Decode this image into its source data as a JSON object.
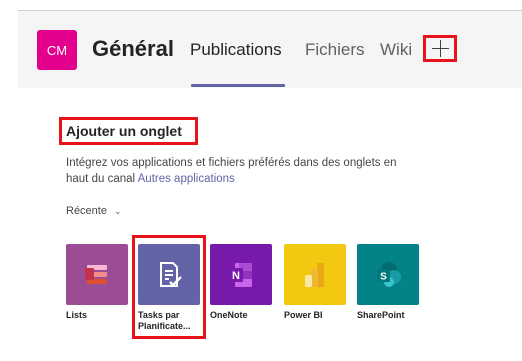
{
  "header": {
    "avatar_initials": "CM",
    "team_name": "Général",
    "tabs": [
      {
        "label": "Publications",
        "active": true
      },
      {
        "label": "Fichiers",
        "active": false
      },
      {
        "label": "Wiki",
        "active": false
      }
    ],
    "add_tab_icon": "plus-icon"
  },
  "dialog": {
    "title": "Ajouter un onglet",
    "description": "Intégrez vos applications et fichiers préférés dans des onglets en haut du canal",
    "more_apps_link": "Autres applications",
    "filter_label": "Récente",
    "filter_icon": "chevron-down-icon"
  },
  "apps": [
    {
      "label": "Lists",
      "icon": "lists-icon",
      "color": "#9a4c95"
    },
    {
      "label": "Tasks par Planificate...",
      "icon": "tasks-icon",
      "color": "#6264a7"
    },
    {
      "label": "OneNote",
      "icon": "onenote-icon",
      "color": "#7719aa"
    },
    {
      "label": "Power BI",
      "icon": "powerbi-icon",
      "color": "#f2c811"
    },
    {
      "label": "SharePoint",
      "icon": "sharepoint-icon",
      "color": "#038387"
    }
  ],
  "colors": {
    "accent": "#6264a7",
    "highlight": "#e8141b",
    "avatar": "#e3008c"
  }
}
